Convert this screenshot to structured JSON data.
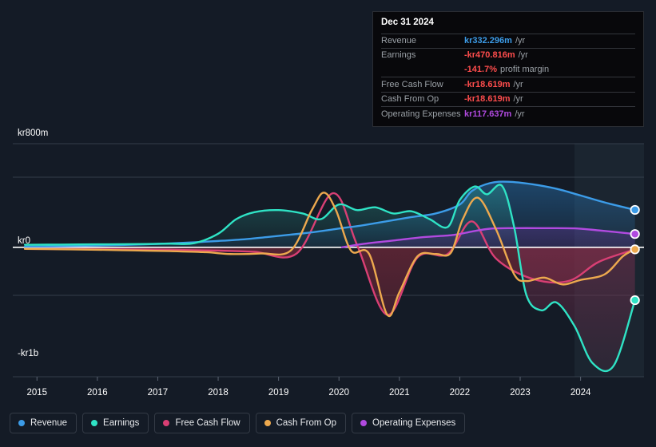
{
  "background_color": "#141b26",
  "tooltip": {
    "date": "Dec 31 2024",
    "rows": [
      {
        "label": "Revenue",
        "value": "kr332.296m",
        "unit": "/yr",
        "color": "#3c9ce8"
      },
      {
        "label": "Earnings",
        "value": "-kr470.816m",
        "unit": "/yr",
        "color": "#ff4d4d"
      },
      {
        "label": "",
        "value": "-141.7%",
        "unit": "profit margin",
        "color": "#ff4d4d",
        "sub": true
      },
      {
        "label": "Free Cash Flow",
        "value": "-kr18.619m",
        "unit": "/yr",
        "color": "#ff4d4d"
      },
      {
        "label": "Cash From Op",
        "value": "-kr18.619m",
        "unit": "/yr",
        "color": "#ff4d4d"
      },
      {
        "label": "Operating Expenses",
        "value": "kr117.637m",
        "unit": "/yr",
        "color": "#b14ae0"
      }
    ]
  },
  "legend": {
    "items": [
      {
        "label": "Revenue",
        "color": "#3c9ce8"
      },
      {
        "label": "Earnings",
        "color": "#2fe3c5"
      },
      {
        "label": "Free Cash Flow",
        "color": "#d93f74"
      },
      {
        "label": "Cash From Op",
        "color": "#eda94e"
      },
      {
        "label": "Operating Expenses",
        "color": "#b14ae0"
      }
    ]
  },
  "chart_data": {
    "type": "area",
    "title": "",
    "xlabel": "",
    "ylabel": "",
    "grid": true,
    "legend_position": "bottom",
    "currency_prefix": "kr",
    "y_axis": {
      "labels": [
        "kr800m",
        "kr0",
        "-kr1b"
      ],
      "label_values": [
        800,
        0,
        -1000
      ],
      "ylim": [
        -1150,
        920
      ],
      "zero_line": true,
      "units": "millions kr"
    },
    "x_axis": {
      "tick_labels": [
        "2015",
        "2016",
        "2017",
        "2018",
        "2019",
        "2020",
        "2021",
        "2022",
        "2023",
        "2024"
      ],
      "xlim": [
        2014.6,
        2025.05
      ],
      "forecast_band_start": "2023.9"
    },
    "series": [
      {
        "name": "Revenue",
        "color": "#3c9ce8",
        "fill": true,
        "x": [
          2014.8,
          2015.2,
          2015.6,
          2016.0,
          2016.4,
          2016.8,
          2017.2,
          2017.6,
          2018.0,
          2018.4,
          2018.8,
          2019.2,
          2019.6,
          2020.0,
          2020.4,
          2020.8,
          2021.2,
          2021.6,
          2022.0,
          2022.2,
          2022.5,
          2022.8,
          2023.2,
          2023.6,
          2024.0,
          2024.4,
          2024.9
        ],
        "values": [
          6,
          8,
          12,
          16,
          20,
          26,
          34,
          44,
          56,
          70,
          90,
          112,
          136,
          166,
          196,
          232,
          268,
          300,
          380,
          500,
          570,
          582,
          560,
          520,
          460,
          398,
          332
        ],
        "end_marker": true
      },
      {
        "name": "Earnings",
        "color": "#2fe3c5",
        "fill": true,
        "x": [
          2014.8,
          2015.4,
          2016.0,
          2016.6,
          2017.2,
          2017.6,
          2018.0,
          2018.3,
          2018.6,
          2019.0,
          2019.4,
          2019.7,
          2020.0,
          2020.3,
          2020.6,
          2020.9,
          2021.2,
          2021.5,
          2021.8,
          2022.0,
          2022.25,
          2022.45,
          2022.7,
          2022.9,
          2023.1,
          2023.35,
          2023.6,
          2023.9,
          2024.2,
          2024.55,
          2024.9
        ],
        "values": [
          22,
          24,
          26,
          28,
          32,
          36,
          120,
          250,
          312,
          330,
          300,
          250,
          380,
          330,
          355,
          300,
          320,
          250,
          180,
          420,
          540,
          470,
          545,
          180,
          -420,
          -560,
          -490,
          -700,
          -1030,
          -1050,
          -470
        ],
        "end_marker": true
      },
      {
        "name": "Free Cash Flow",
        "color": "#d93f74",
        "fill": true,
        "x": [
          2014.8,
          2016.0,
          2017.2,
          2018.0,
          2018.6,
          2019.3,
          2019.9,
          2020.3,
          2020.8,
          2021.3,
          2021.8,
          2022.2,
          2022.6,
          2023.2,
          2023.8,
          2024.3,
          2024.9
        ],
        "values": [
          -14,
          -18,
          -22,
          -30,
          -40,
          -55,
          480,
          20,
          -600,
          -90,
          -60,
          230,
          -100,
          -280,
          -300,
          -130,
          -18.6
        ],
        "end_marker": false
      },
      {
        "name": "Cash From Op",
        "color": "#eda94e",
        "fill": false,
        "x": [
          2014.8,
          2015.4,
          2016.0,
          2016.6,
          2017.2,
          2017.8,
          2018.2,
          2018.7,
          2019.2,
          2019.55,
          2019.75,
          2019.95,
          2020.2,
          2020.5,
          2020.8,
          2021.0,
          2021.3,
          2021.6,
          2021.85,
          2022.05,
          2022.3,
          2022.6,
          2022.9,
          2023.1,
          2023.4,
          2023.7,
          2024.0,
          2024.4,
          2024.7,
          2024.9
        ],
        "values": [
          -14,
          -18,
          -22,
          -28,
          -34,
          -44,
          -60,
          -55,
          -30,
          330,
          485,
          330,
          -30,
          -60,
          -600,
          -400,
          -80,
          -60,
          -50,
          250,
          440,
          160,
          -240,
          -300,
          -270,
          -330,
          -290,
          -240,
          -80,
          -18.6
        ],
        "end_marker": true
      },
      {
        "name": "Operating Expenses",
        "color": "#b14ae0",
        "fill": true,
        "x": [
          2020.05,
          2020.4,
          2020.9,
          2021.4,
          2021.9,
          2022.2,
          2022.5,
          2022.9,
          2023.4,
          2023.9,
          2024.3,
          2024.9
        ],
        "values": [
          0,
          30,
          60,
          90,
          110,
          140,
          165,
          170,
          170,
          168,
          150,
          117.6
        ],
        "end_marker": true
      }
    ]
  }
}
